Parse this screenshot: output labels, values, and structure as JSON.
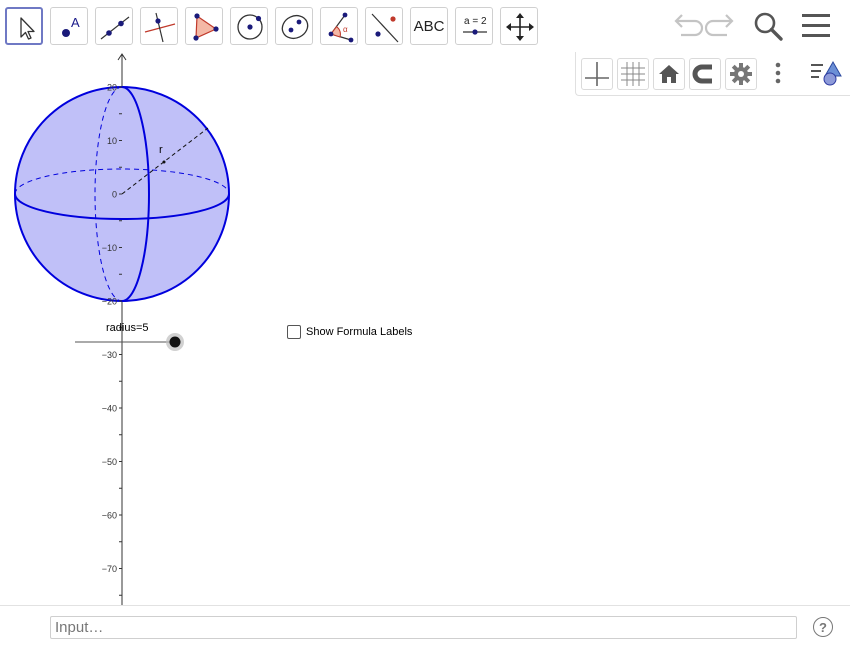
{
  "toolbar": {
    "tools": [
      {
        "name": "move-tool",
        "icon": "arrow-cursor-icon",
        "active": true
      },
      {
        "name": "point-tool",
        "icon": "point-icon"
      },
      {
        "name": "line-tool",
        "icon": "line-through-two-points-icon"
      },
      {
        "name": "perpendicular-line-tool",
        "icon": "perpendicular-line-icon"
      },
      {
        "name": "polygon-tool",
        "icon": "polygon-icon"
      },
      {
        "name": "circle-tool",
        "icon": "circle-center-point-icon"
      },
      {
        "name": "conic-tool",
        "icon": "ellipse-icon"
      },
      {
        "name": "angle-tool",
        "icon": "angle-icon"
      },
      {
        "name": "reflect-tool",
        "icon": "reflect-about-line-icon"
      },
      {
        "name": "text-tool",
        "label": "ABC"
      },
      {
        "name": "slider-tool",
        "label": "a = 2",
        "icon": "slider-icon"
      },
      {
        "name": "move-graphics-view-tool",
        "icon": "move-arrows-icon"
      }
    ],
    "header_icons": [
      "undo-icon",
      "redo-icon",
      "search-icon",
      "menu-icon"
    ]
  },
  "style_bar": {
    "buttons": [
      "axes-icon",
      "grid-icon",
      "home-icon",
      "magnet-icon",
      "gear-icon",
      "more-vertical-icon",
      "graphics-style-icon"
    ]
  },
  "graphics": {
    "y_axis_ticks": [
      "20",
      "10",
      "0",
      "−10",
      "−20",
      "−30",
      "−40",
      "−50",
      "−60",
      "−70"
    ],
    "segment_label": "r",
    "slider_label": "radius=5",
    "slider_value": 5,
    "checkbox": {
      "label": "Show Formula Labels",
      "checked": false
    },
    "colors": {
      "sphere_fill": "#c0c0f8",
      "sphere_stroke": "#0000dd",
      "accent": "#6f79c4"
    }
  },
  "input_bar": {
    "placeholder": "Input…",
    "help_label": "?"
  }
}
